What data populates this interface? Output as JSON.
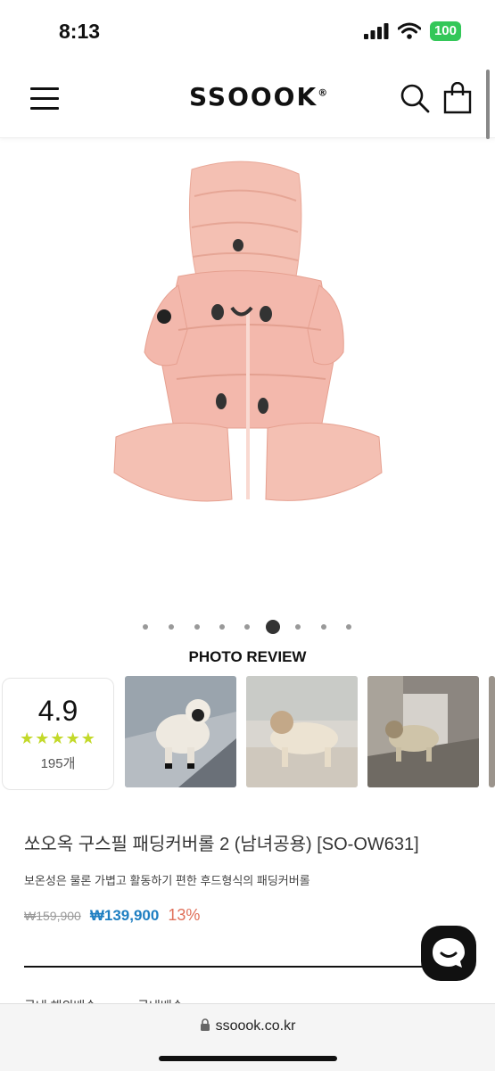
{
  "status": {
    "time": "8:13",
    "battery": "100"
  },
  "header": {
    "logo": "SSOOOK",
    "logo_mark": "®"
  },
  "carousel": {
    "total": 9,
    "active_index": 5
  },
  "photo_review": {
    "title": "PHOTO REVIEW",
    "rating": "4.9",
    "stars": "★★★★★",
    "count": "195개"
  },
  "product": {
    "title": "쏘오옥 구스필 패딩커버롤 2 (남녀공용) [SO-OW631]",
    "description": "보온성은 물론 가볍고 활동하기 편한 후드형식의 패딩커버롤",
    "price_original": "₩159,900",
    "price_sale": "₩139,900",
    "discount": "13%"
  },
  "partial_row": {
    "label": "국내 해외배송",
    "value": "국내배송"
  },
  "browser": {
    "url": "ssoook.co.kr"
  },
  "colors": {
    "accent_price": "#1f7fc2",
    "discount": "#e0705a",
    "star": "#c3d92a",
    "battery": "#34c759",
    "product": "#f3b8ac"
  }
}
